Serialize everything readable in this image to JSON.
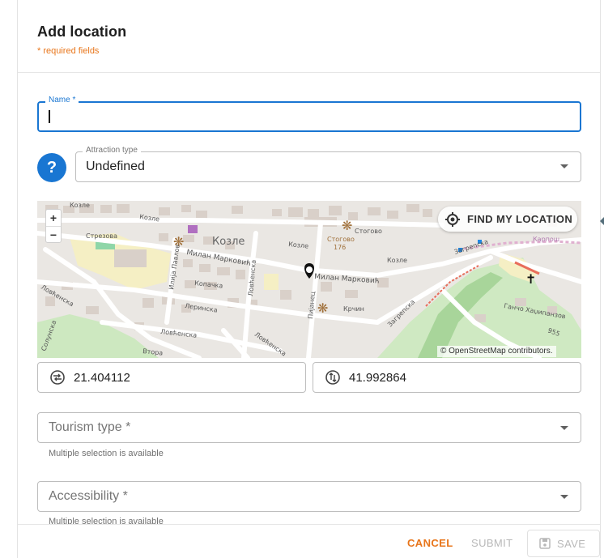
{
  "dialog": {
    "title": "Add location",
    "required_note": "* required fields"
  },
  "name_field": {
    "label": "Name *",
    "value": ""
  },
  "attraction_type": {
    "help_icon_glyph": "?",
    "label": "Attraction type",
    "value": "Undefined"
  },
  "map": {
    "zoom_in": "+",
    "zoom_out": "−",
    "find_my_location": "FIND MY LOCATION",
    "attribution": "© OpenStreetMap contributors.",
    "labels": {
      "kozle": "Козле",
      "kozle_small": "Козле",
      "kozle_east": "Козле",
      "strezova": "Стрезова",
      "milan_markovic_w": "Милан Марковић",
      "milan_markovic_e": "Милан Марковић",
      "kopacka": "Копачка",
      "lovcenska_w": "Ловћенска",
      "lovcenska_c": "Ловћенска",
      "lovcenska_s": "Ловћенска",
      "lovcenska_v": "Ловћенска",
      "lerinska": "Леринска",
      "ilija_pavlov": "Илија Павлов",
      "pijanec": "Пијанец",
      "krcin": "Крчин",
      "zagrepska": "Загрепска",
      "zagrepska_2": "Загрепска",
      "gancho": "Ганчо Хаџипанзов",
      "stogovo": "Стогово",
      "stogovo_176": "Стогово",
      "num_176": "176",
      "num_955": "955",
      "karposh": "Карпош",
      "solunska": "Солунска",
      "vtora": "Втора"
    }
  },
  "coordinates": {
    "longitude": "21.404112",
    "latitude": "41.992864"
  },
  "tourism_type": {
    "placeholder": "Tourism type *",
    "helper": "Multiple selection is available"
  },
  "accessibility": {
    "placeholder": "Accessibility *",
    "helper": "Multiple selection is available"
  },
  "footer": {
    "cancel": "CANCEL",
    "submit": "SUBMIT",
    "save": "SAVE"
  },
  "colors": {
    "primary": "#1976d2",
    "accent": "#e8751a",
    "disabled": "#b8b8b8"
  }
}
